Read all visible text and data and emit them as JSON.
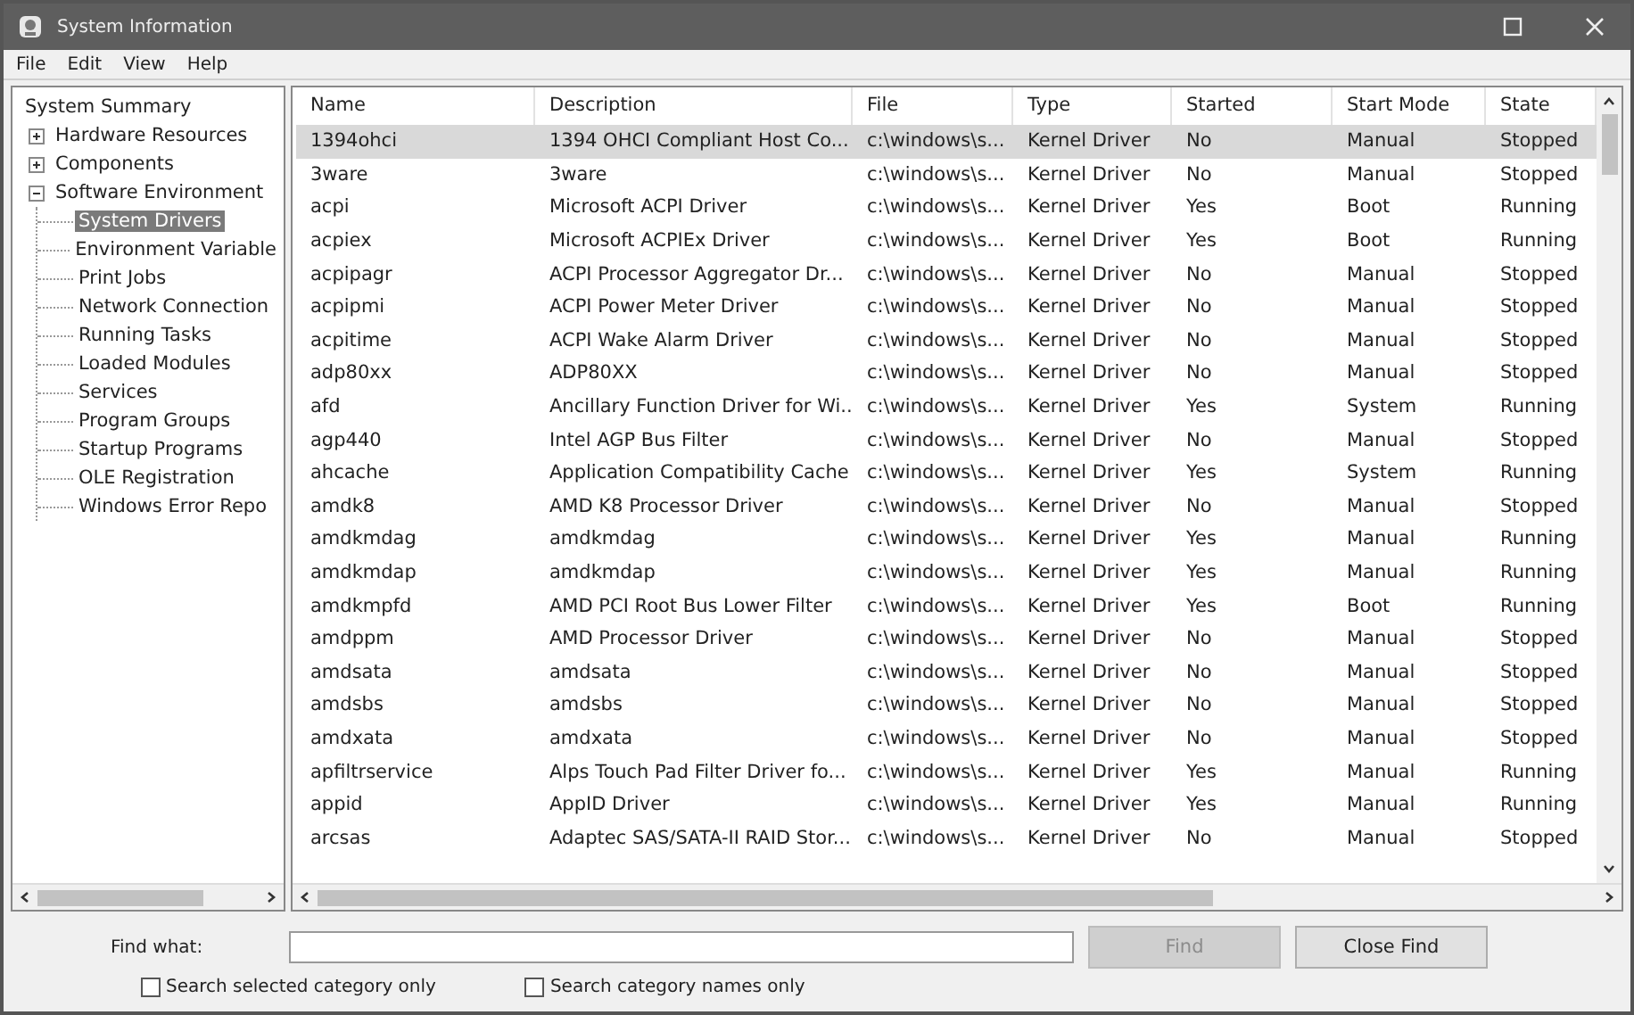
{
  "window": {
    "title": "System Information"
  },
  "menu": [
    {
      "label": "File"
    },
    {
      "label": "Edit"
    },
    {
      "label": "View"
    },
    {
      "label": "Help"
    }
  ],
  "tree": [
    {
      "label": "System Summary",
      "selected": false,
      "children": [
        {
          "label": "Hardware Resources",
          "expanded": false,
          "selected": false
        },
        {
          "label": "Components",
          "expanded": false,
          "selected": false
        },
        {
          "label": "Software Environment",
          "expanded": true,
          "selected": false,
          "children": [
            {
              "label": "System Drivers",
              "selected": true
            },
            {
              "label": "Environment Variable",
              "selected": false
            },
            {
              "label": "Print Jobs",
              "selected": false
            },
            {
              "label": "Network Connection",
              "selected": false
            },
            {
              "label": "Running Tasks",
              "selected": false
            },
            {
              "label": "Loaded Modules",
              "selected": false
            },
            {
              "label": "Services",
              "selected": false
            },
            {
              "label": "Program Groups",
              "selected": false
            },
            {
              "label": "Startup Programs",
              "selected": false
            },
            {
              "label": "OLE Registration",
              "selected": false
            },
            {
              "label": "Windows Error Repo",
              "selected": false
            }
          ]
        }
      ]
    }
  ],
  "table": {
    "columns": [
      "Name",
      "Description",
      "File",
      "Type",
      "Started",
      "Start Mode",
      "State"
    ],
    "rows": [
      {
        "selected": true,
        "cells": [
          "1394ohci",
          "1394 OHCI Compliant Host Co...",
          "c:\\windows\\s...",
          "Kernel Driver",
          "No",
          "Manual",
          "Stopped"
        ]
      },
      {
        "selected": false,
        "cells": [
          "3ware",
          "3ware",
          "c:\\windows\\s...",
          "Kernel Driver",
          "No",
          "Manual",
          "Stopped"
        ]
      },
      {
        "selected": false,
        "cells": [
          "acpi",
          "Microsoft ACPI Driver",
          "c:\\windows\\s...",
          "Kernel Driver",
          "Yes",
          "Boot",
          "Running"
        ]
      },
      {
        "selected": false,
        "cells": [
          "acpiex",
          "Microsoft ACPIEx Driver",
          "c:\\windows\\s...",
          "Kernel Driver",
          "Yes",
          "Boot",
          "Running"
        ]
      },
      {
        "selected": false,
        "cells": [
          "acpipagr",
          "ACPI Processor Aggregator Dr...",
          "c:\\windows\\s...",
          "Kernel Driver",
          "No",
          "Manual",
          "Stopped"
        ]
      },
      {
        "selected": false,
        "cells": [
          "acpipmi",
          "ACPI Power Meter Driver",
          "c:\\windows\\s...",
          "Kernel Driver",
          "No",
          "Manual",
          "Stopped"
        ]
      },
      {
        "selected": false,
        "cells": [
          "acpitime",
          "ACPI Wake Alarm Driver",
          "c:\\windows\\s...",
          "Kernel Driver",
          "No",
          "Manual",
          "Stopped"
        ]
      },
      {
        "selected": false,
        "cells": [
          "adp80xx",
          "ADP80XX",
          "c:\\windows\\s...",
          "Kernel Driver",
          "No",
          "Manual",
          "Stopped"
        ]
      },
      {
        "selected": false,
        "cells": [
          "afd",
          "Ancillary Function Driver for Wi...",
          "c:\\windows\\s...",
          "Kernel Driver",
          "Yes",
          "System",
          "Running"
        ]
      },
      {
        "selected": false,
        "cells": [
          "agp440",
          "Intel AGP Bus Filter",
          "c:\\windows\\s...",
          "Kernel Driver",
          "No",
          "Manual",
          "Stopped"
        ]
      },
      {
        "selected": false,
        "cells": [
          "ahcache",
          "Application Compatibility Cache",
          "c:\\windows\\s...",
          "Kernel Driver",
          "Yes",
          "System",
          "Running"
        ]
      },
      {
        "selected": false,
        "cells": [
          "amdk8",
          "AMD K8 Processor Driver",
          "c:\\windows\\s...",
          "Kernel Driver",
          "No",
          "Manual",
          "Stopped"
        ]
      },
      {
        "selected": false,
        "cells": [
          "amdkmdag",
          "amdkmdag",
          "c:\\windows\\s...",
          "Kernel Driver",
          "Yes",
          "Manual",
          "Running"
        ]
      },
      {
        "selected": false,
        "cells": [
          "amdkmdap",
          "amdkmdap",
          "c:\\windows\\s...",
          "Kernel Driver",
          "Yes",
          "Manual",
          "Running"
        ]
      },
      {
        "selected": false,
        "cells": [
          "amdkmpfd",
          "AMD PCI Root Bus Lower Filter",
          "c:\\windows\\s...",
          "Kernel Driver",
          "Yes",
          "Boot",
          "Running"
        ]
      },
      {
        "selected": false,
        "cells": [
          "amdppm",
          "AMD Processor Driver",
          "c:\\windows\\s...",
          "Kernel Driver",
          "No",
          "Manual",
          "Stopped"
        ]
      },
      {
        "selected": false,
        "cells": [
          "amdsata",
          "amdsata",
          "c:\\windows\\s...",
          "Kernel Driver",
          "No",
          "Manual",
          "Stopped"
        ]
      },
      {
        "selected": false,
        "cells": [
          "amdsbs",
          "amdsbs",
          "c:\\windows\\s...",
          "Kernel Driver",
          "No",
          "Manual",
          "Stopped"
        ]
      },
      {
        "selected": false,
        "cells": [
          "amdxata",
          "amdxata",
          "c:\\windows\\s...",
          "Kernel Driver",
          "No",
          "Manual",
          "Stopped"
        ]
      },
      {
        "selected": false,
        "cells": [
          "apfiltrservice",
          "Alps Touch Pad Filter Driver fo...",
          "c:\\windows\\s...",
          "Kernel Driver",
          "Yes",
          "Manual",
          "Running"
        ]
      },
      {
        "selected": false,
        "cells": [
          "appid",
          "AppID Driver",
          "c:\\windows\\s...",
          "Kernel Driver",
          "Yes",
          "Manual",
          "Running"
        ]
      },
      {
        "selected": false,
        "cells": [
          "arcsas",
          "Adaptec SAS/SATA-II RAID Stor...",
          "c:\\windows\\s...",
          "Kernel Driver",
          "No",
          "Manual",
          "Stopped"
        ]
      }
    ]
  },
  "find": {
    "label": "Find what:",
    "find_button": {
      "label": "Find",
      "disabled": true
    },
    "close_button": {
      "label": "Close Find",
      "disabled": false
    },
    "options": [
      {
        "label": "Search selected category only",
        "checked": false
      },
      {
        "label": "Search category names only",
        "checked": false
      }
    ]
  }
}
